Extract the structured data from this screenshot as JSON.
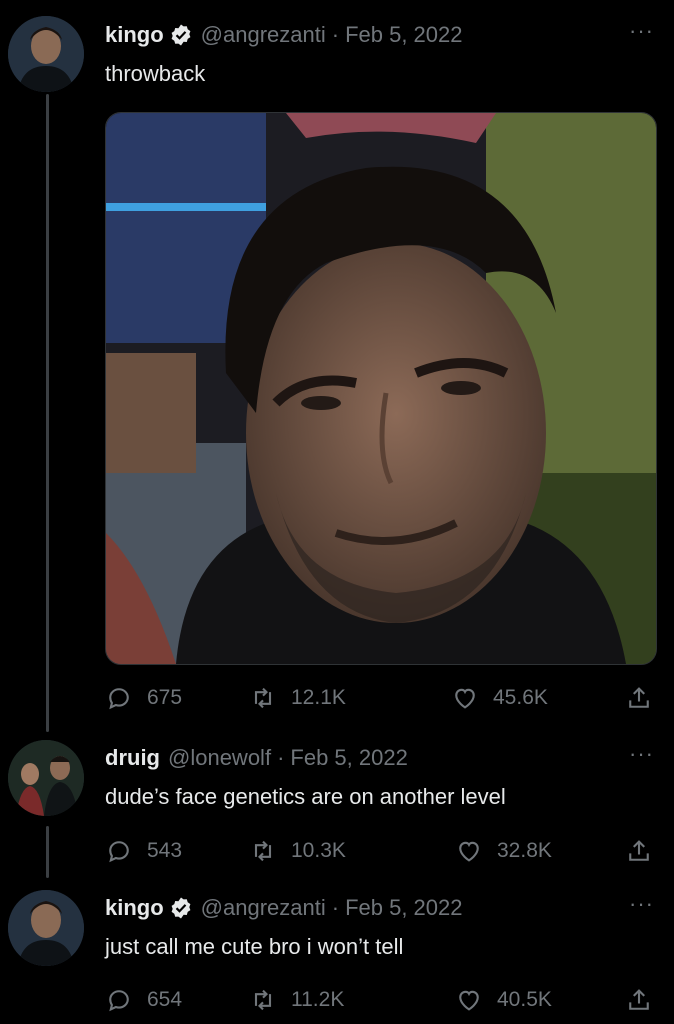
{
  "tweets": [
    {
      "name": "kingo",
      "verified": true,
      "handle": "@angrezanti",
      "date": "Feb 5, 2022",
      "text": "throwback",
      "replies": "675",
      "retweets": "12.1K",
      "likes": "45.6K"
    },
    {
      "name": "druig",
      "verified": false,
      "handle": "@lonewolf",
      "date": "Feb 5, 2022",
      "text": "dude’s face genetics are on another level",
      "replies": "543",
      "retweets": "10.3K",
      "likes": "32.8K"
    },
    {
      "name": "kingo",
      "verified": true,
      "handle": "@angrezanti",
      "date": "Feb 5, 2022",
      "text": "just call me cute bro i won’t tell",
      "replies": "654",
      "retweets": "11.2K",
      "likes": "40.5K"
    }
  ],
  "separator": "·",
  "more_label": "···",
  "icons": {
    "reply": "reply-icon",
    "retweet": "retweet-icon",
    "like": "heart-icon",
    "share": "share-icon",
    "verified": "verified-badge-icon",
    "more": "more-icon"
  },
  "colors": {
    "background": "#000000",
    "text": "#e7e9ea",
    "muted": "#71767b",
    "thread_line": "#3b3f43"
  }
}
